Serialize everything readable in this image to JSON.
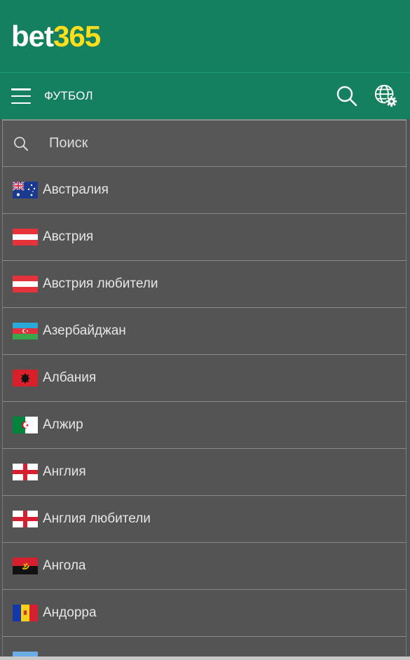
{
  "brand": {
    "logo_white": "bet",
    "logo_yellow": "365"
  },
  "nav": {
    "title": "ФУТБОЛ"
  },
  "search": {
    "placeholder": "Поиск"
  },
  "countries": [
    {
      "label": "Австралия",
      "flag": "australia"
    },
    {
      "label": "Австрия",
      "flag": "austria"
    },
    {
      "label": "Австрия любители",
      "flag": "austria"
    },
    {
      "label": "Азербайджан",
      "flag": "azerbaijan"
    },
    {
      "label": "Албания",
      "flag": "albania"
    },
    {
      "label": "Алжир",
      "flag": "algeria"
    },
    {
      "label": "Англия",
      "flag": "england"
    },
    {
      "label": "Англия любители",
      "flag": "england"
    },
    {
      "label": "Ангола",
      "flag": "angola"
    },
    {
      "label": "Андорра",
      "flag": "andorra"
    },
    {
      "label": "",
      "flag": "argentina"
    }
  ],
  "colors": {
    "header": "#14805e",
    "logo_yellow": "#ffdf1b",
    "list_bg": "#535353"
  }
}
